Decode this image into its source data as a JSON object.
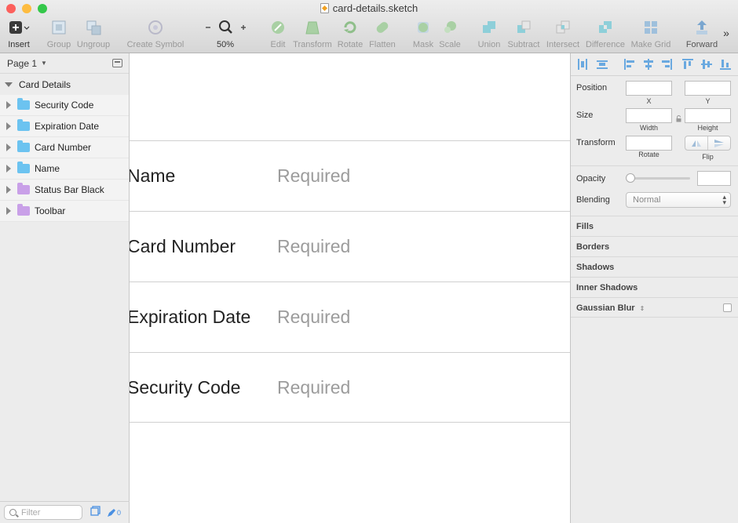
{
  "window": {
    "title": "card-details.sketch"
  },
  "toolbar": {
    "insert": "Insert",
    "group": "Group",
    "ungroup": "Ungroup",
    "create_symbol": "Create Symbol",
    "zoom_level": "50%",
    "edit": "Edit",
    "transform": "Transform",
    "rotate": "Rotate",
    "flatten": "Flatten",
    "mask": "Mask",
    "scale": "Scale",
    "union": "Union",
    "subtract": "Subtract",
    "intersect": "Intersect",
    "difference": "Difference",
    "make_grid": "Make Grid",
    "forward": "Forward"
  },
  "sidebar": {
    "page_selector": "Page 1",
    "artboard": "Card Details",
    "layers": [
      {
        "label": "Security Code",
        "icon": "folder-icon",
        "color": "#6cc3f0"
      },
      {
        "label": "Expiration Date",
        "icon": "folder-icon",
        "color": "#6cc3f0"
      },
      {
        "label": "Card Number",
        "icon": "folder-icon",
        "color": "#6cc3f0"
      },
      {
        "label": "Name",
        "icon": "folder-icon",
        "color": "#6cc3f0"
      },
      {
        "label": "Status Bar Black",
        "icon": "symbol-folder-icon",
        "color": "#c9a0e8"
      },
      {
        "label": "Toolbar",
        "icon": "symbol-folder-icon",
        "color": "#c9a0e8"
      }
    ],
    "filter_placeholder": "Filter",
    "edited_count": "0"
  },
  "canvas": {
    "rows": [
      {
        "label": "Name",
        "value": "Required"
      },
      {
        "label": "Card Number",
        "value": "Required"
      },
      {
        "label": "Expiration Date",
        "value": "Required"
      },
      {
        "label": "Security Code",
        "value": "Required"
      }
    ]
  },
  "inspector": {
    "position": "Position",
    "x": "X",
    "y": "Y",
    "size": "Size",
    "width": "Width",
    "height": "Height",
    "transform": "Transform",
    "rotate": "Rotate",
    "flip": "Flip",
    "opacity": "Opacity",
    "blending": "Blending",
    "blending_value": "Normal",
    "sections": [
      "Fills",
      "Borders",
      "Shadows",
      "Inner Shadows",
      "Gaussian Blur"
    ]
  },
  "colors": {
    "close": "#fc605c",
    "minimize": "#fdbc40",
    "zoom": "#34c84a",
    "accent": "#4a90e2"
  }
}
